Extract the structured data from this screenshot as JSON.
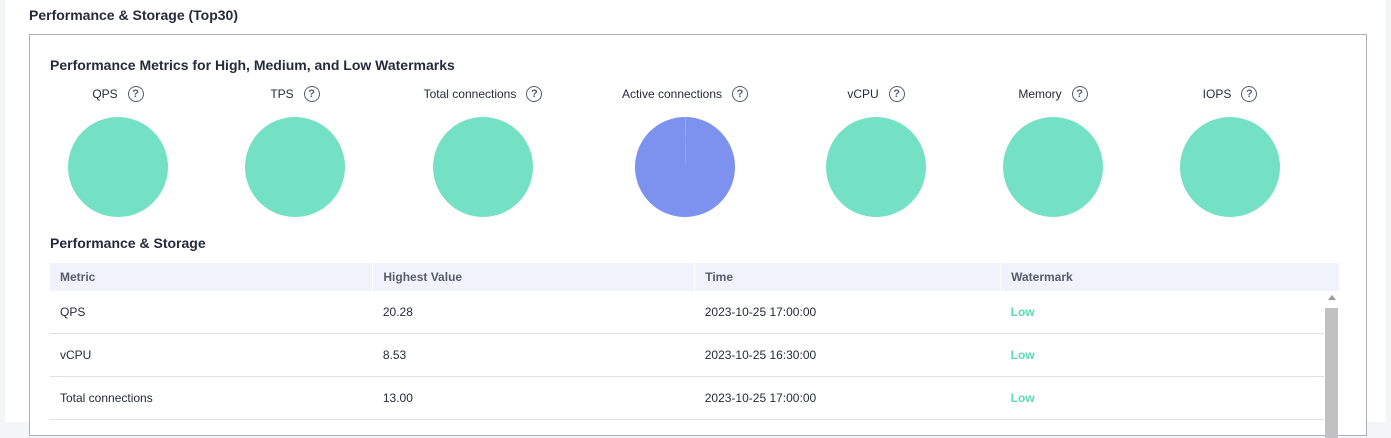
{
  "page_title": "Performance & Storage (Top30)",
  "watermarks_title": "Performance Metrics for High, Medium, and Low Watermarks",
  "help_glyph": "?",
  "metrics": [
    {
      "label": "QPS",
      "pie": [
        {
          "value": 100,
          "color": "#74e1c5"
        }
      ]
    },
    {
      "label": "TPS",
      "pie": [
        {
          "value": 100,
          "color": "#74e1c5"
        }
      ]
    },
    {
      "label": "Total connections",
      "pie": [
        {
          "value": 100,
          "color": "#74e1c5"
        }
      ]
    },
    {
      "label": "Active connections",
      "pie": [
        {
          "value": 0.3,
          "color": "#f08f6f"
        },
        {
          "value": 99.7,
          "color": "#7d92ef"
        }
      ]
    },
    {
      "label": "vCPU",
      "pie": [
        {
          "value": 100,
          "color": "#74e1c5"
        }
      ]
    },
    {
      "label": "Memory",
      "pie": [
        {
          "value": 100,
          "color": "#74e1c5"
        }
      ]
    },
    {
      "label": "IOPS",
      "pie": [
        {
          "value": 100,
          "color": "#74e1c5"
        }
      ]
    }
  ],
  "table_title": "Performance & Storage",
  "table": {
    "headers": [
      "Metric",
      "Highest Value",
      "Time",
      "Watermark"
    ],
    "rows": [
      [
        "QPS",
        "20.28",
        "2023-10-25 17:00:00",
        "Low"
      ],
      [
        "vCPU",
        "8.53",
        "2023-10-25 16:30:00",
        "Low"
      ],
      [
        "Total connections",
        "13.00",
        "2023-10-25 17:00:00",
        "Low"
      ]
    ]
  },
  "colors": {
    "low": "#5ed8b5",
    "accent_blue": "#7d92ef",
    "accent_green": "#74e1c5"
  }
}
